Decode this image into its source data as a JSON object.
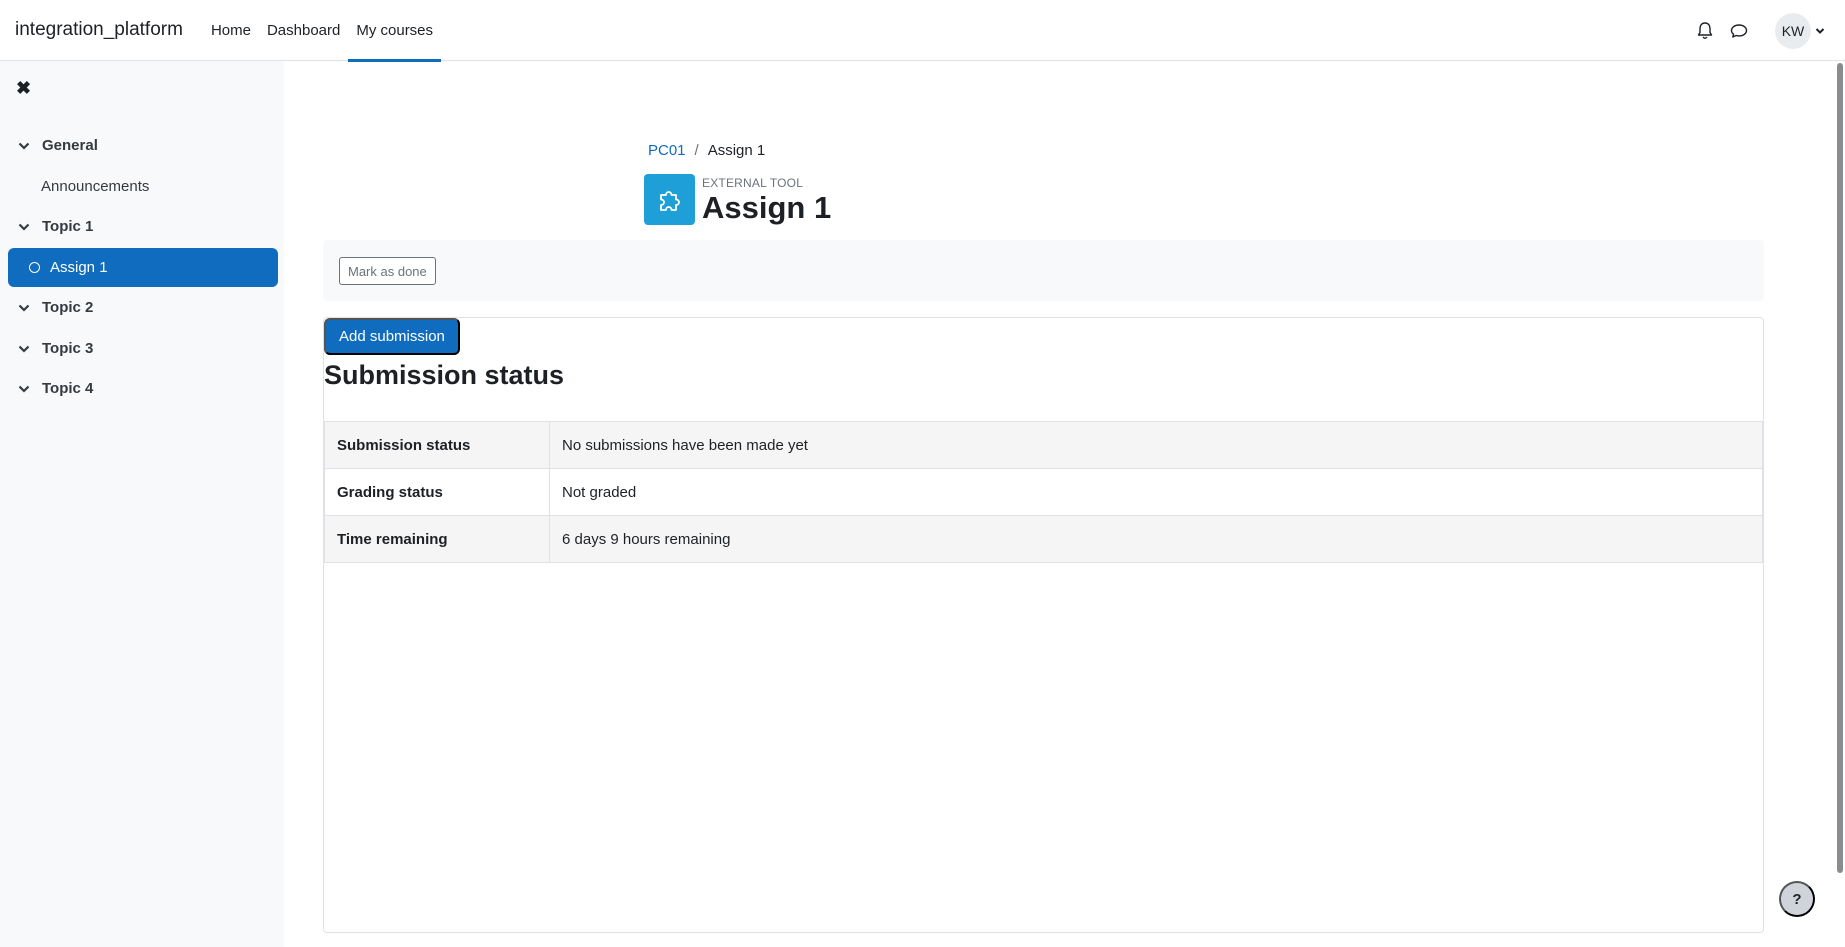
{
  "navbar": {
    "brand": "integration_platform",
    "links": [
      {
        "label": "Home"
      },
      {
        "label": "Dashboard"
      },
      {
        "label": "My courses"
      }
    ],
    "user_initials": "KW"
  },
  "drawer": {
    "sections": [
      {
        "label": "General",
        "items": [
          {
            "label": "Announcements"
          }
        ]
      },
      {
        "label": "Topic 1",
        "items": [
          {
            "label": "Assign 1",
            "active": true
          }
        ]
      },
      {
        "label": "Topic 2",
        "items": []
      },
      {
        "label": "Topic 3",
        "items": []
      },
      {
        "label": "Topic 4",
        "items": []
      }
    ]
  },
  "breadcrumb": {
    "course": "PC01",
    "separator": "/",
    "current": "Assign 1"
  },
  "header": {
    "activity_kind": "EXTERNAL TOOL",
    "title": "Assign 1",
    "icon": "puzzle-piece-icon",
    "icon_color": "#1f9fd8"
  },
  "completion": {
    "mark_done_label": "Mark as done"
  },
  "submission": {
    "add_button_label": "Add submission",
    "heading": "Submission status",
    "rows": [
      {
        "label": "Submission status",
        "value": "No submissions have been made yet"
      },
      {
        "label": "Grading status",
        "value": "Not graded"
      },
      {
        "label": "Time remaining",
        "value": "6 days 9 hours remaining"
      }
    ]
  },
  "help": {
    "label": "?"
  },
  "colors": {
    "accent": "#0f6cbf"
  }
}
